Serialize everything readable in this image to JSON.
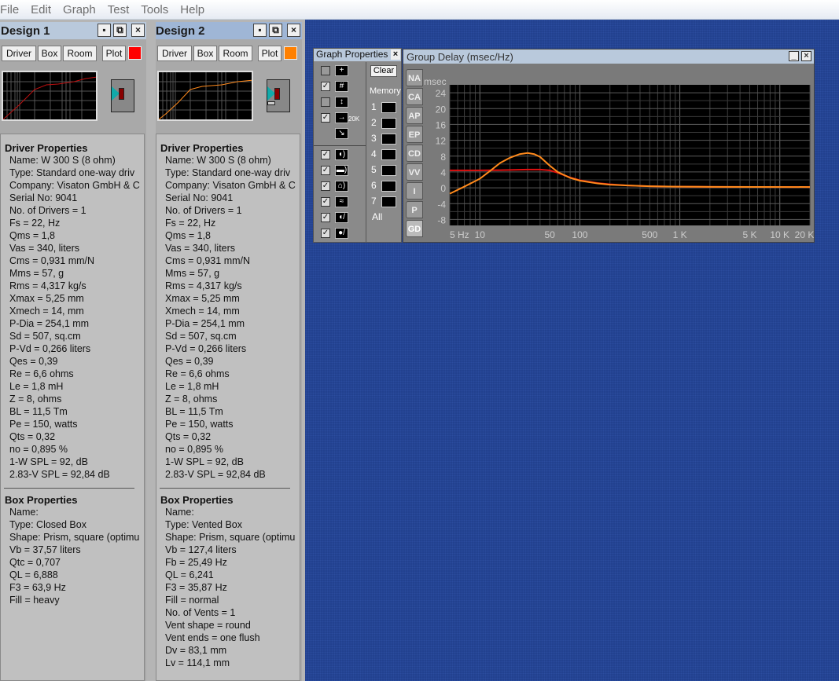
{
  "menu": [
    "File",
    "Edit",
    "Graph",
    "Test",
    "Tools",
    "Help"
  ],
  "designs": [
    {
      "title": "Design 1",
      "buttons": {
        "driver": "Driver",
        "box": "Box",
        "room": "Room",
        "plot": "Plot"
      },
      "color": "#ff0000",
      "driver_header": "Driver Properties",
      "driver": [
        "Name: W 300 S  (8 ohm)",
        "Type: Standard one-way driv",
        "Company: Visaton GmbH & C",
        "Serial No: 9041",
        "No. of Drivers = 1",
        "Fs =  22, Hz",
        "Qms =  1,8",
        "Vas =  340, liters",
        "Cms =  0,931 mm/N",
        "Mms =  57, g",
        "Rms =  4,317 kg/s",
        "Xmax =  5,25 mm",
        "Xmech =  14, mm",
        "P-Dia =  254,1 mm",
        "Sd =  507, sq.cm",
        "P-Vd =  0,266 liters",
        "Qes =  0,39",
        "Re =  6,6 ohms",
        "Le =  1,8 mH",
        "Z =  8, ohms",
        "BL =  11,5 Tm",
        "Pe =  150, watts",
        "Qts =  0,32",
        "no =  0,895 %",
        "1-W SPL =  92, dB",
        "2.83-V SPL =  92,84 dB"
      ],
      "box_header": "Box Properties",
      "box": [
        "Name:",
        "Type: Closed Box",
        "Shape: Prism, square (optimu",
        "Vb =  37,57 liters",
        "Qtc =  0,707",
        "QL =  6,888",
        "F3 =  63,9 Hz",
        "Fill = heavy"
      ]
    },
    {
      "title": "Design 2",
      "buttons": {
        "driver": "Driver",
        "box": "Box",
        "room": "Room",
        "plot": "Plot"
      },
      "color": "#ff8000",
      "driver_header": "Driver Properties",
      "driver": [
        "Name: W 300 S  (8 ohm)",
        "Type: Standard one-way driv",
        "Company: Visaton GmbH & C",
        "Serial No: 9041",
        "No. of Drivers = 1",
        "Fs =  22, Hz",
        "Qms =  1,8",
        "Vas =  340, liters",
        "Cms =  0,931 mm/N",
        "Mms =  57, g",
        "Rms =  4,317 kg/s",
        "Xmax =  5,25 mm",
        "Xmech =  14, mm",
        "P-Dia =  254,1 mm",
        "Sd =  507, sq.cm",
        "P-Vd =  0,266 liters",
        "Qes =  0,39",
        "Re =  6,6 ohms",
        "Le =  1,8 mH",
        "Z =  8, ohms",
        "BL =  11,5 Tm",
        "Pe =  150, watts",
        "Qts =  0,32",
        "no =  0,895 %",
        "1-W SPL =  92, dB",
        "2.83-V SPL =  92,84 dB"
      ],
      "box_header": "Box Properties",
      "box": [
        "Name:",
        "Type: Vented Box",
        "Shape: Prism, square (optimu",
        "Vb =  127,4 liters",
        "Fb =  25,49 Hz",
        "QL =  6,241",
        "F3 =  35,87 Hz",
        "Fill = normal",
        "No. of Vents = 1",
        "  Vent shape = round",
        "  Vent ends = one flush",
        "  Dv =  83,1 mm",
        "  Lv =  114,1 mm"
      ]
    }
  ],
  "graph_props": {
    "title": "Graph Properties",
    "clear": "Clear",
    "memory": "Memory",
    "slots": [
      "1",
      "2",
      "3",
      "4",
      "5",
      "6",
      "7"
    ],
    "all": "All",
    "toggles": [
      {
        "icon": "crosshair-icon",
        "checked": false
      },
      {
        "icon": "grid-icon",
        "checked": true
      },
      {
        "icon": "autoscale-icon",
        "checked": false
      },
      {
        "icon": "range-20k-icon",
        "checked": true,
        "label": "20K"
      },
      {
        "icon": "speaker-icon",
        "checked": true
      },
      {
        "icon": "box-icon",
        "checked": true
      },
      {
        "icon": "room-icon",
        "checked": true
      },
      {
        "icon": "crossover-icon",
        "checked": true
      },
      {
        "icon": "driver-response-icon",
        "checked": true
      },
      {
        "icon": "port-response-icon",
        "checked": true
      }
    ]
  },
  "graph": {
    "title": "Group Delay (msec/Hz)",
    "tabs": [
      "NA",
      "CA",
      "AP",
      "EP",
      "CD",
      "VV",
      "I",
      "P",
      "GD"
    ],
    "active_tab": "GD"
  },
  "chart_data": {
    "type": "line",
    "ylabel": "msec",
    "ylim": [
      -9.5,
      26
    ],
    "xlim": [
      5,
      20000
    ],
    "xscale": "log",
    "grid": true,
    "yticks": [
      "24",
      "20",
      "16",
      "12",
      "8",
      "4",
      "0",
      "-4",
      "-8"
    ],
    "xticks": [
      {
        "v": 5,
        "l": "5 Hz"
      },
      {
        "v": 10,
        "l": "10"
      },
      {
        "v": 50,
        "l": "50"
      },
      {
        "v": 100,
        "l": "100"
      },
      {
        "v": 500,
        "l": "500"
      },
      {
        "v": 1000,
        "l": "1 K"
      },
      {
        "v": 5000,
        "l": "5 K"
      },
      {
        "v": 10000,
        "l": "10 K"
      },
      {
        "v": 20000,
        "l": "20 K"
      }
    ],
    "series": [
      {
        "color": "#e01010",
        "x": [
          5,
          10,
          20,
          30,
          40,
          50,
          60,
          80,
          100,
          150,
          200,
          300,
          500,
          900,
          2000,
          20000
        ],
        "y": [
          4.4,
          4.4,
          4.5,
          4.6,
          4.6,
          4.4,
          3.8,
          2.6,
          1.9,
          1.2,
          0.9,
          0.6,
          0.4,
          0.3,
          0.25,
          0.2
        ]
      },
      {
        "color": "#ff8a1c",
        "x": [
          5,
          7,
          10,
          13,
          16,
          20,
          25,
          30,
          35,
          40,
          50,
          60,
          80,
          100,
          150,
          200,
          300,
          500,
          900,
          2000,
          20000
        ],
        "y": [
          -1.5,
          0.3,
          2.3,
          4.5,
          6.3,
          7.6,
          8.5,
          8.8,
          8.5,
          7.8,
          5.6,
          4.0,
          2.5,
          1.8,
          1.1,
          0.8,
          0.6,
          0.4,
          0.3,
          0.25,
          0.2
        ]
      }
    ]
  }
}
